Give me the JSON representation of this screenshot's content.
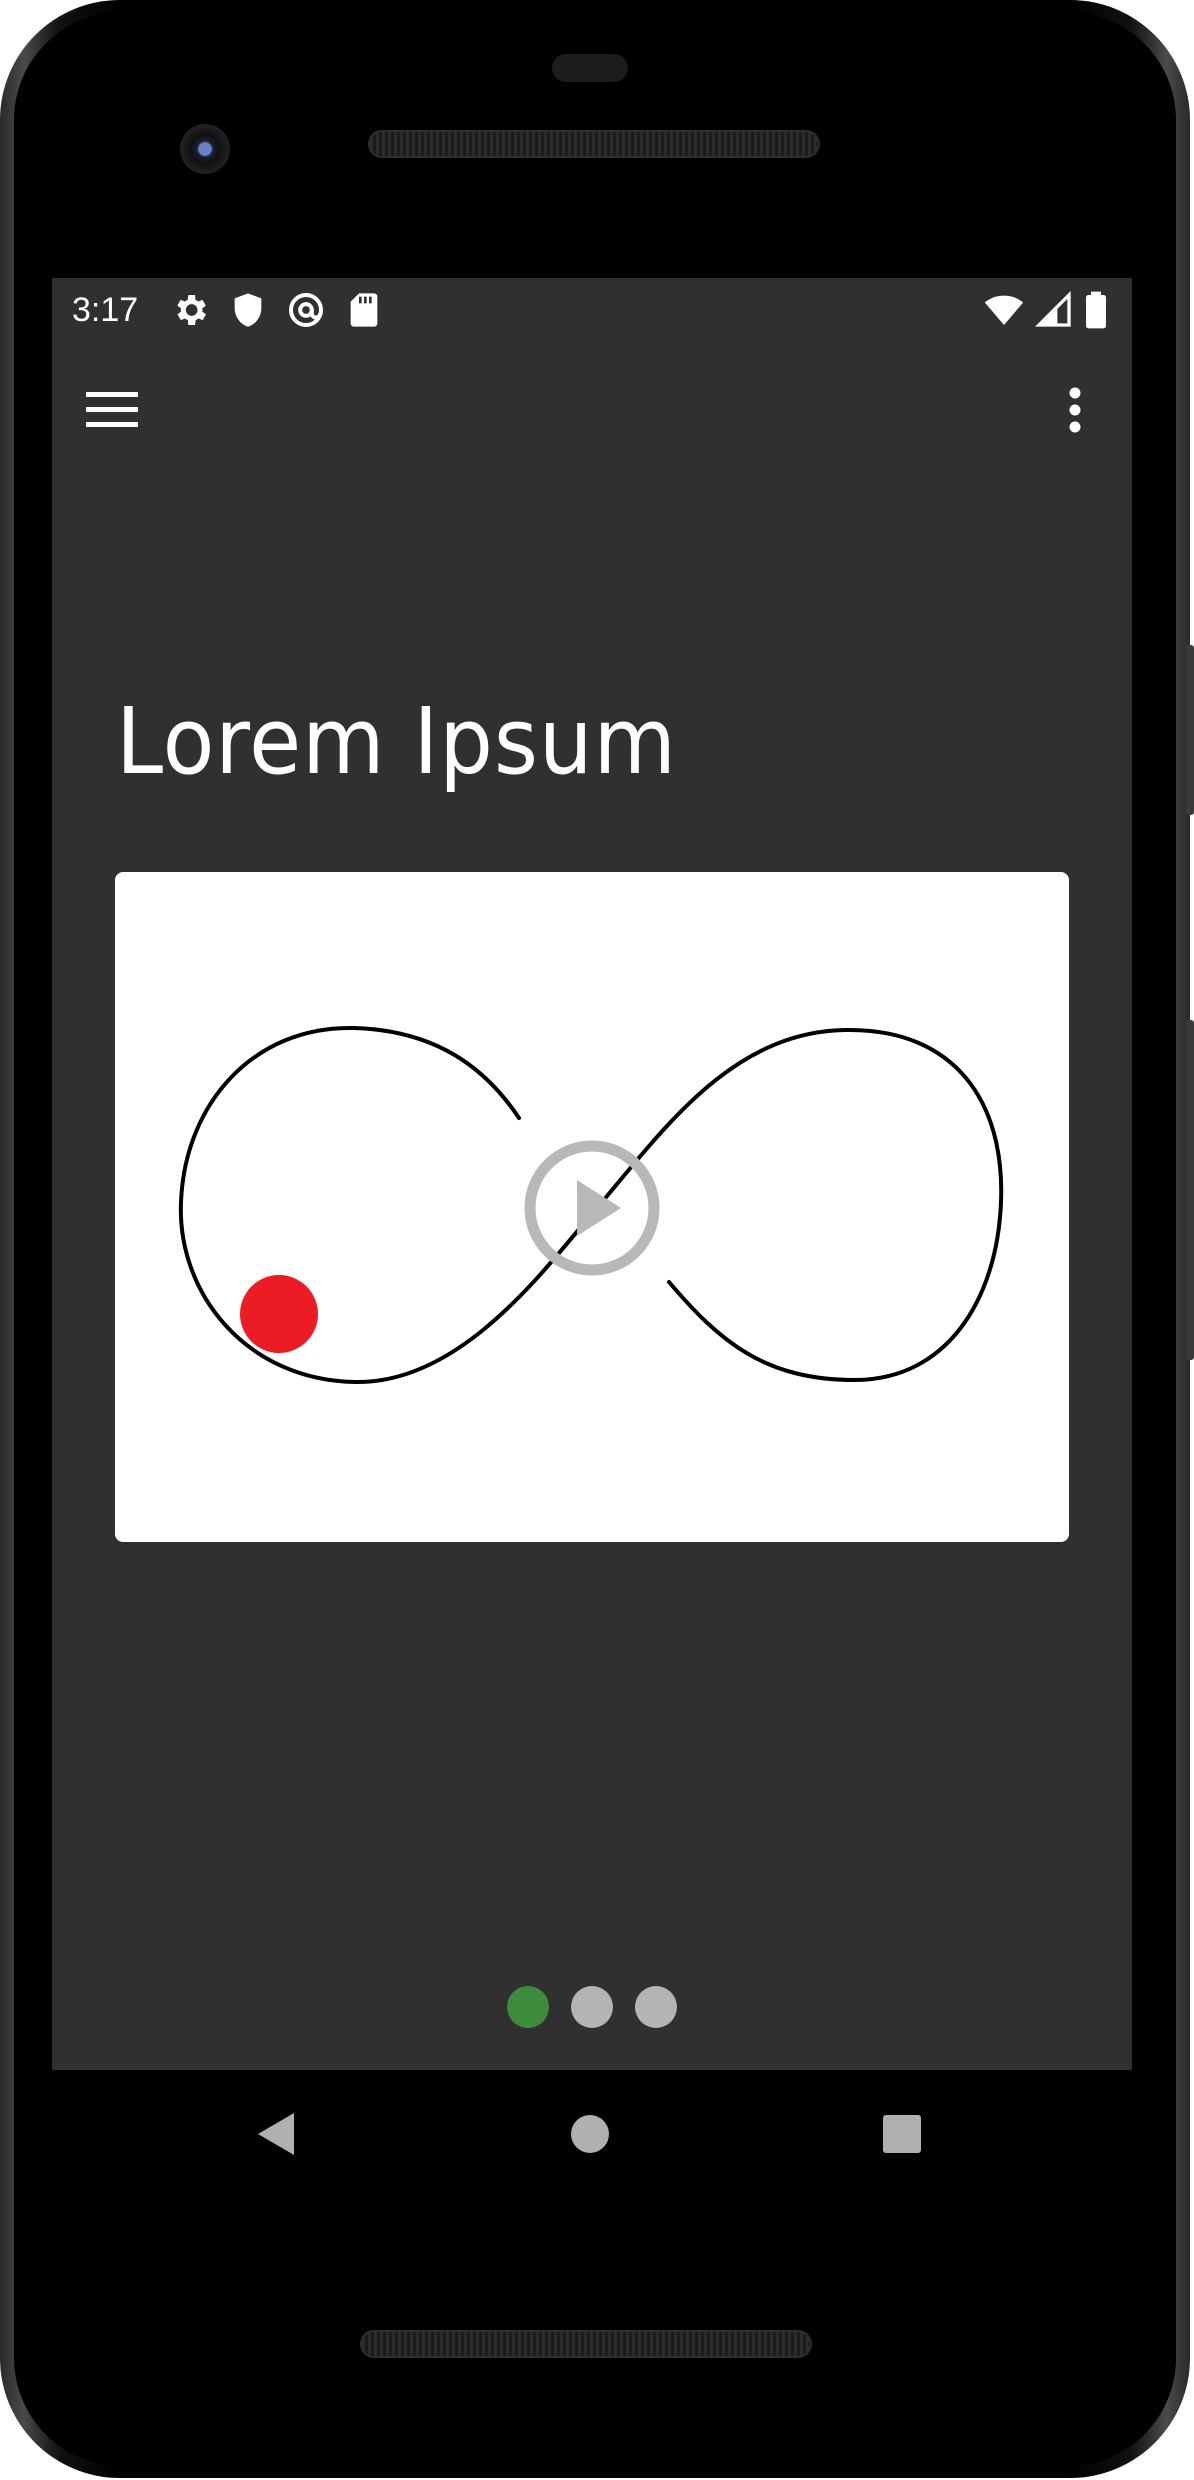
{
  "status_bar": {
    "time": "3:17",
    "left_icons": [
      "gear-icon",
      "shield-icon",
      "at-sign-icon",
      "sd-card-icon"
    ],
    "right_icons": [
      "wifi-icon",
      "cell-signal-icon",
      "battery-icon"
    ]
  },
  "app_bar": {
    "menu_icon": "hamburger-menu-icon",
    "overflow_icon": "more-vertical-icon"
  },
  "main": {
    "title": "Lorem Ipsum",
    "media": {
      "play_icon": "play-icon"
    }
  },
  "pager": {
    "page_count": 3,
    "active_index": 0
  },
  "nav_bar": {
    "buttons": [
      "back-icon",
      "home-icon",
      "recents-icon"
    ]
  },
  "colors": {
    "screen_background": "#303030",
    "active_dot": "#3c8c3c",
    "inactive_dot": "#b4b4b4",
    "ball": "#ec1c24",
    "play_overlay": "#b8b8b8",
    "text": "#ffffff"
  }
}
